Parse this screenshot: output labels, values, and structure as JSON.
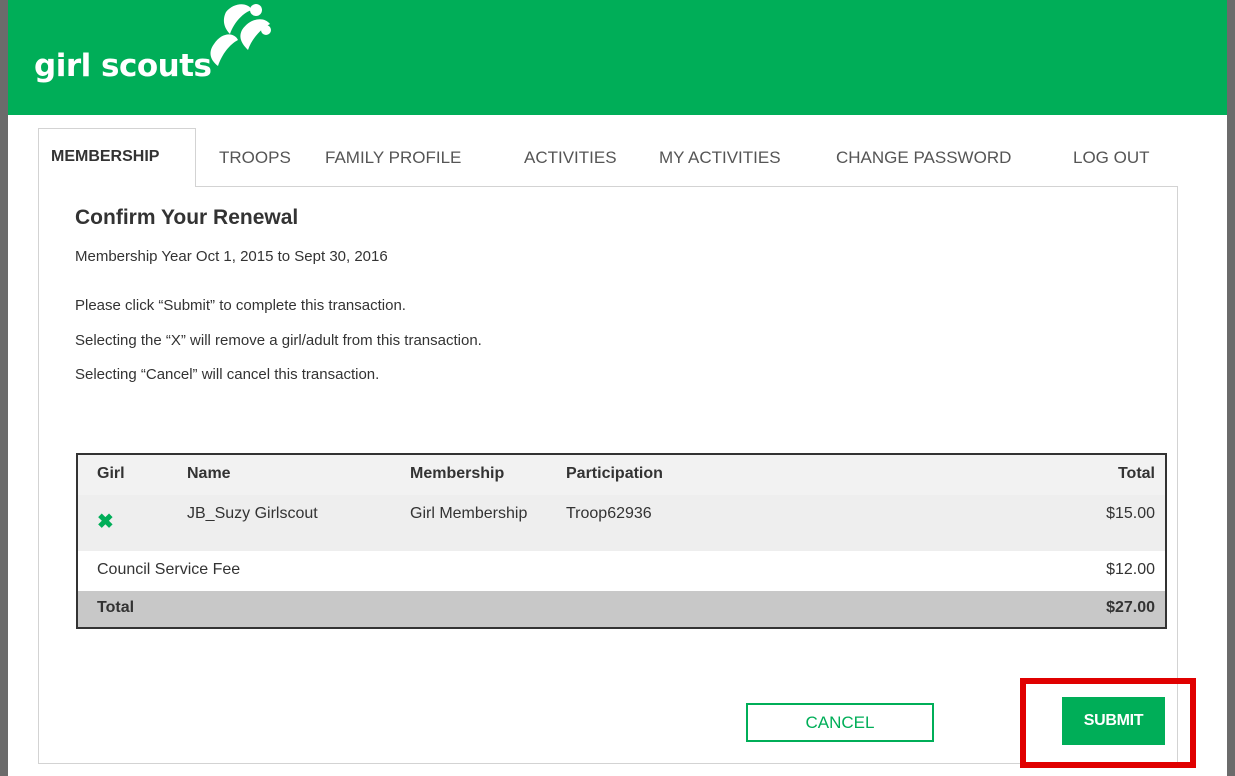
{
  "brand": {
    "logo_text": "girl scouts",
    "accent": "#00ae58",
    "highlight_color": "#e00000"
  },
  "nav": {
    "items": [
      {
        "label": "MEMBERSHIP",
        "active": true
      },
      {
        "label": "TROOPS"
      },
      {
        "label": "FAMILY PROFILE"
      },
      {
        "label": "ACTIVITIES"
      },
      {
        "label": "MY ACTIVITIES"
      },
      {
        "label": "CHANGE PASSWORD"
      },
      {
        "label": "LOG OUT"
      }
    ]
  },
  "content": {
    "title": "Confirm Your Renewal",
    "membership_year": "Membership Year Oct 1, 2015 to Sept 30, 2016",
    "instructions": [
      "Please click “Submit” to complete this transaction.",
      "Selecting the “X” will remove a girl/adult from this transaction.",
      "Selecting “Cancel” will cancel this transaction."
    ]
  },
  "table": {
    "headers": {
      "girl": "Girl",
      "name": "Name",
      "membership": "Membership",
      "participation": "Participation",
      "total": "Total"
    },
    "rows": [
      {
        "remove_icon": "x-icon",
        "remove_glyph": "✖",
        "name": "JB_Suzy Girlscout",
        "membership": "Girl Membership",
        "participation": "Troop62936",
        "total": "$15.00"
      }
    ],
    "fee": {
      "label": "Council Service Fee",
      "amount": "$12.00"
    },
    "grand_total": {
      "label": "Total",
      "amount": "$27.00"
    }
  },
  "actions": {
    "cancel_label": "CANCEL",
    "submit_label": "SUBMIT"
  }
}
